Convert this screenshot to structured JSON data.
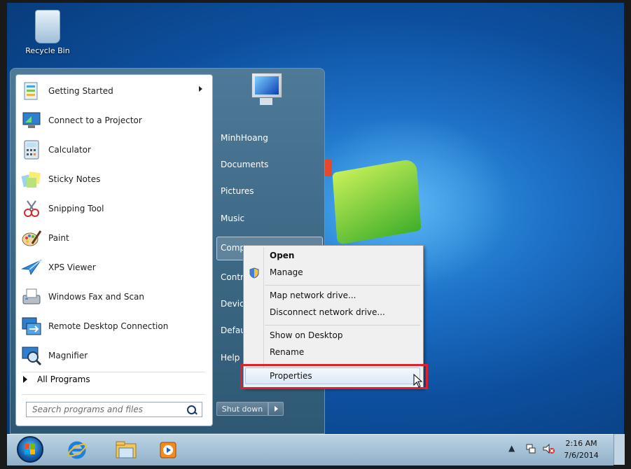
{
  "desktop": {
    "recycle_bin_label": "Recycle Bin"
  },
  "start_menu": {
    "programs": [
      {
        "label": "Getting Started",
        "icon": "getting-started-icon",
        "has_submenu": true
      },
      {
        "label": "Connect to a Projector",
        "icon": "projector-icon"
      },
      {
        "label": "Calculator",
        "icon": "calculator-icon"
      },
      {
        "label": "Sticky Notes",
        "icon": "sticky-notes-icon"
      },
      {
        "label": "Snipping Tool",
        "icon": "snipping-tool-icon"
      },
      {
        "label": "Paint",
        "icon": "paint-icon"
      },
      {
        "label": "XPS Viewer",
        "icon": "xps-viewer-icon"
      },
      {
        "label": "Windows Fax and Scan",
        "icon": "fax-scan-icon"
      },
      {
        "label": "Remote Desktop Connection",
        "icon": "remote-desktop-icon"
      },
      {
        "label": "Magnifier",
        "icon": "magnifier-icon"
      }
    ],
    "all_programs_label": "All Programs",
    "search_placeholder": "Search programs and files",
    "right_items": [
      "MinhHoang",
      "Documents",
      "Pictures",
      "Music",
      "Comp",
      "Contr",
      "Devic",
      "Defau",
      "Help"
    ],
    "shutdown_label": "Shut down"
  },
  "context_menu": {
    "items": [
      {
        "label": "Open",
        "bold": true
      },
      {
        "label": "Manage",
        "icon": "shield-icon"
      },
      {
        "label": "Map network drive..."
      },
      {
        "label": "Disconnect network drive..."
      },
      {
        "label": "Show on Desktop"
      },
      {
        "label": "Rename"
      },
      {
        "label": "Properties",
        "highlighted": true
      }
    ]
  },
  "taskbar": {
    "pinned": [
      "internet-explorer-icon",
      "file-explorer-icon",
      "media-player-icon"
    ],
    "clock_time": "2:16 AM",
    "clock_date": "7/6/2014"
  }
}
